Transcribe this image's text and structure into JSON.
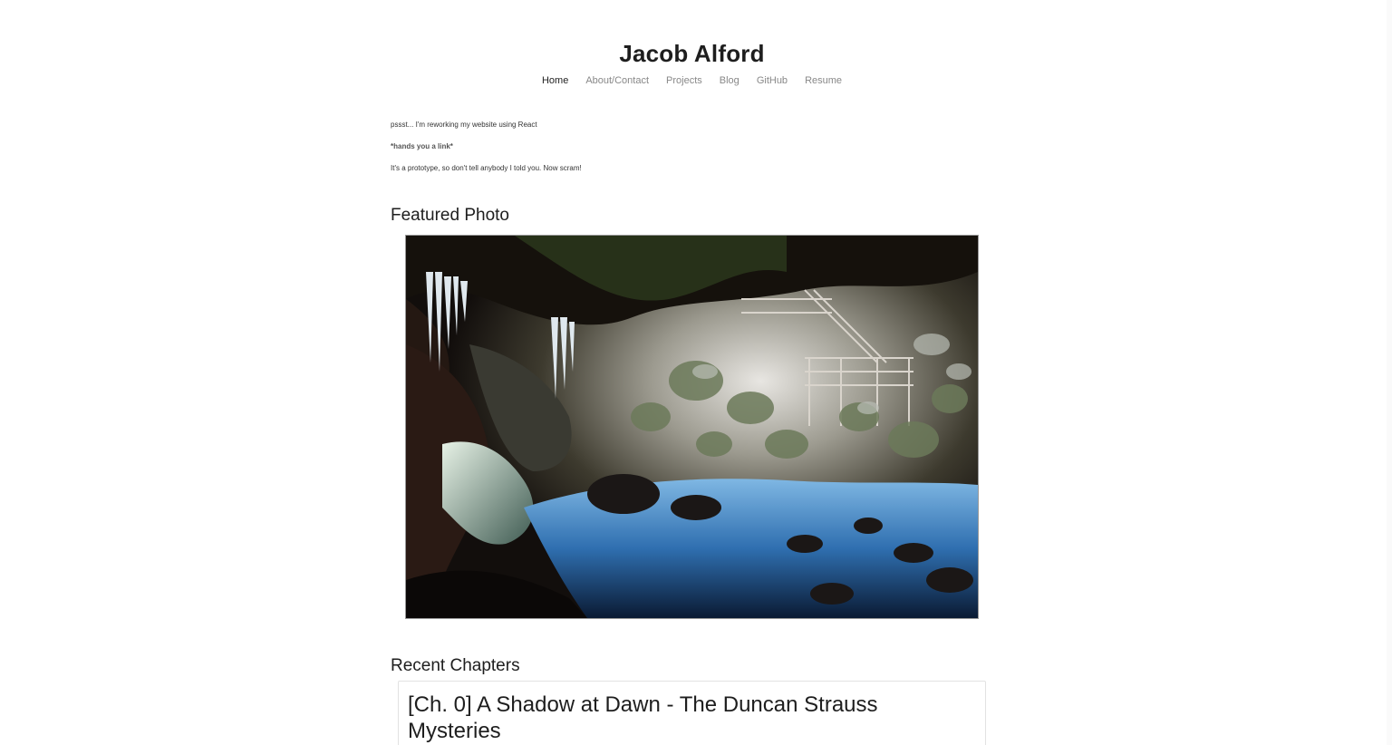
{
  "site": {
    "title": "Jacob Alford"
  },
  "nav": {
    "items": [
      {
        "label": "Home",
        "active": true
      },
      {
        "label": "About/Contact",
        "active": false
      },
      {
        "label": "Projects",
        "active": false
      },
      {
        "label": "Blog",
        "active": false
      },
      {
        "label": "GitHub",
        "active": false
      },
      {
        "label": "Resume",
        "active": false
      }
    ]
  },
  "intro": {
    "line1": "pssst... I'm reworking my website using React",
    "line2": "*hands you a link*",
    "line3": "It's a prototype, so don't tell anybody I told you. Now scram!"
  },
  "featured": {
    "heading": "Featured Photo",
    "photo_subject": "ice cave with wooden staircase"
  },
  "recent": {
    "heading": "Recent Chapters",
    "chapters": [
      {
        "title": "[Ch. 0] A Shadow at Dawn - The Duncan Strauss Mysteries"
      }
    ]
  },
  "colors": {
    "text": "#1e1e1e",
    "nav_inactive": "#888888",
    "nav_active": "#222222"
  }
}
